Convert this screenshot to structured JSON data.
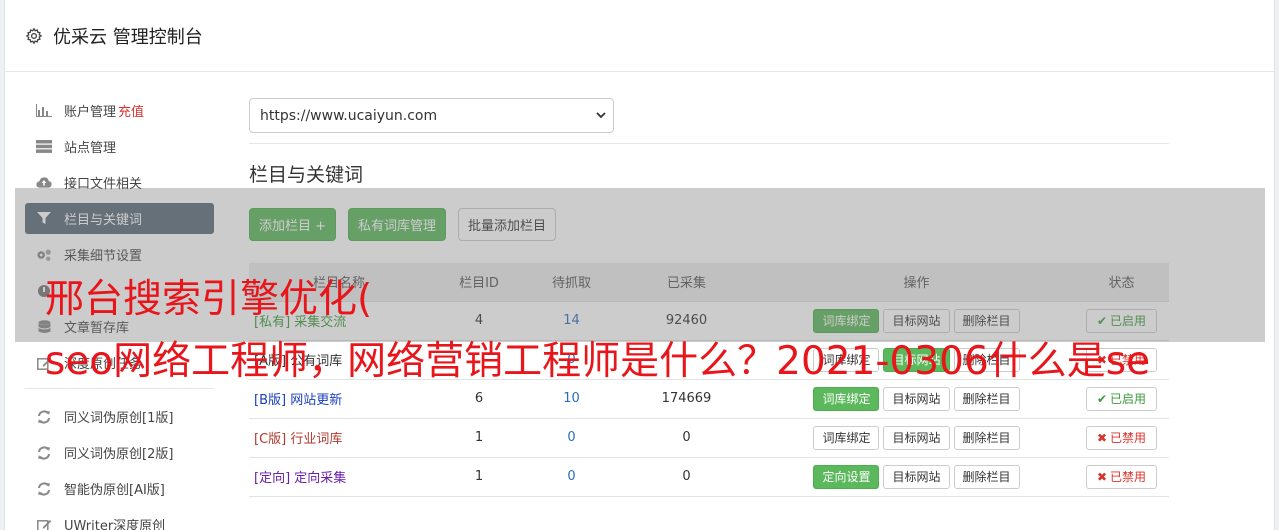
{
  "header": {
    "title": "优采云 管理控制台",
    "icon": "gear-icon"
  },
  "sidebar": {
    "items": [
      {
        "label": "账户管理",
        "icon": "bar-chart-icon",
        "extra": "充值"
      },
      {
        "label": "站点管理",
        "icon": "server-icon"
      },
      {
        "label": "接口文件相关",
        "icon": "cloud-upload-icon"
      },
      {
        "label": "栏目与关键词",
        "icon": "filter-icon",
        "active": true
      },
      {
        "label": "采集细节设置",
        "icon": "gears-icon"
      },
      {
        "label": "",
        "icon": "circle-icon"
      },
      {
        "label": "文章暂存库",
        "icon": "database-icon"
      },
      {
        "label": "深度原创任务",
        "icon": "edit-icon"
      }
    ],
    "items2": [
      {
        "label": "同义词伪原创[1版]",
        "icon": "refresh-icon"
      },
      {
        "label": "同义词伪原创[2版]",
        "icon": "refresh-icon"
      },
      {
        "label": "智能伪原创[AI版]",
        "icon": "refresh-icon"
      },
      {
        "label": "UWriter深度原创",
        "icon": "edit-icon"
      }
    ]
  },
  "main": {
    "site_select": "https://www.ucaiyun.com",
    "section_title": "栏目与关键词",
    "buttons": {
      "add": "添加栏目 +",
      "private_lib": "私有词库管理",
      "batch_add": "批量添加栏目"
    },
    "table": {
      "headers": [
        "栏目名称",
        "栏目ID",
        "待抓取",
        "已采集",
        "操作",
        "状态"
      ],
      "rows": [
        {
          "tag": "[私有]",
          "name": "采集交流",
          "id": "4",
          "pending": "14",
          "collected": "92460",
          "op1": "词库绑定",
          "op1_green": true,
          "op2": "目标网站",
          "op2_green": false,
          "op3": "删除栏目",
          "status": "已启用",
          "on": true,
          "color": "#3c9a3c"
        },
        {
          "tag": "[A版]",
          "name": "公有词库",
          "id": "",
          "pending": "0",
          "collected": "",
          "op1": "词库绑定",
          "op1_green": false,
          "op2": "目标网站",
          "op2_green": true,
          "op3": "删除栏目",
          "status": "已禁用",
          "on": false,
          "color": "#333333"
        },
        {
          "tag": "[B版]",
          "name": "网站更新",
          "id": "6",
          "pending": "10",
          "collected": "174669",
          "op1": "词库绑定",
          "op1_green": true,
          "op2": "目标网站",
          "op2_green": false,
          "op3": "删除栏目",
          "status": "已启用",
          "on": true,
          "color": "#1a3fbf"
        },
        {
          "tag": "[C版]",
          "name": "行业词库",
          "id": "1",
          "pending": "0",
          "collected": "0",
          "op1": "词库绑定",
          "op1_green": false,
          "op2": "目标网站",
          "op2_green": false,
          "op3": "删除栏目",
          "status": "已禁用",
          "on": false,
          "color": "#b03a2e"
        },
        {
          "tag": "[定向]",
          "name": "定向采集",
          "id": "1",
          "pending": "0",
          "collected": "0",
          "op1": "定向设置",
          "op1_green": true,
          "op2": "目标网站",
          "op2_green": false,
          "op3": "删除栏目",
          "status": "已禁用",
          "on": false,
          "color": "#6a1fa8"
        }
      ]
    }
  },
  "overlay": {
    "line1": "邢台搜索引擎优化(",
    "line2": "seo网络工程师，网络营销工程师是什么？2021-0306什么是se"
  },
  "colors": {
    "green": "#5cb85c",
    "active_nav": "#5b6b7a",
    "red": "#d9332e"
  }
}
